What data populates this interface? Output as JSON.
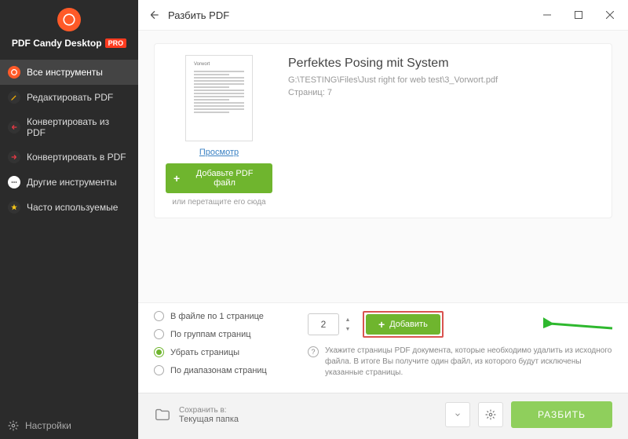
{
  "brand": {
    "name": "PDF Candy Desktop",
    "badge": "PRO"
  },
  "sidebar": {
    "items": [
      {
        "label": "Все инструменты",
        "icon": "candy",
        "color": "#ff5a28",
        "active": true
      },
      {
        "label": "Редактировать PDF",
        "icon": "pencil",
        "color": "#ffb400"
      },
      {
        "label": "Конвертировать из PDF",
        "icon": "arrow-left",
        "color": "#e63946"
      },
      {
        "label": "Конвертировать в PDF",
        "icon": "arrow-right",
        "color": "#e63946"
      },
      {
        "label": "Другие инструменты",
        "icon": "dots",
        "color": "#ffffff"
      },
      {
        "label": "Часто используемые",
        "icon": "star",
        "color": "#f5c518"
      }
    ],
    "settings": "Настройки"
  },
  "header": {
    "title": "Разбить PDF"
  },
  "file": {
    "title": "Perfektes Posing mit System",
    "path": "G:\\TESTING\\Files\\Just right for web test\\3_Vorwort.pdf",
    "pages_label": "Страниц: 7",
    "preview": "Просмотр",
    "add_label": "Добавьте PDF файл",
    "drag_hint": "или перетащите его сюда",
    "thumb_title": "Vorwort"
  },
  "options": {
    "radios": [
      {
        "label": "В файле по 1 странице",
        "checked": false
      },
      {
        "label": "По группам страниц",
        "checked": false
      },
      {
        "label": "Убрать страницы",
        "checked": true
      },
      {
        "label": "По диапазонам страниц",
        "checked": false
      }
    ],
    "value": "2",
    "add_label": "Добавить",
    "hint": "Укажите страницы PDF документа, которые необходимо удалить из исходного файла. В итоге Вы получите один файл, из которого будут исключены указанные страницы."
  },
  "footer": {
    "save_label": "Сохранить в:",
    "save_path": "Текущая папка",
    "split_label": "РАЗБИТЬ"
  }
}
